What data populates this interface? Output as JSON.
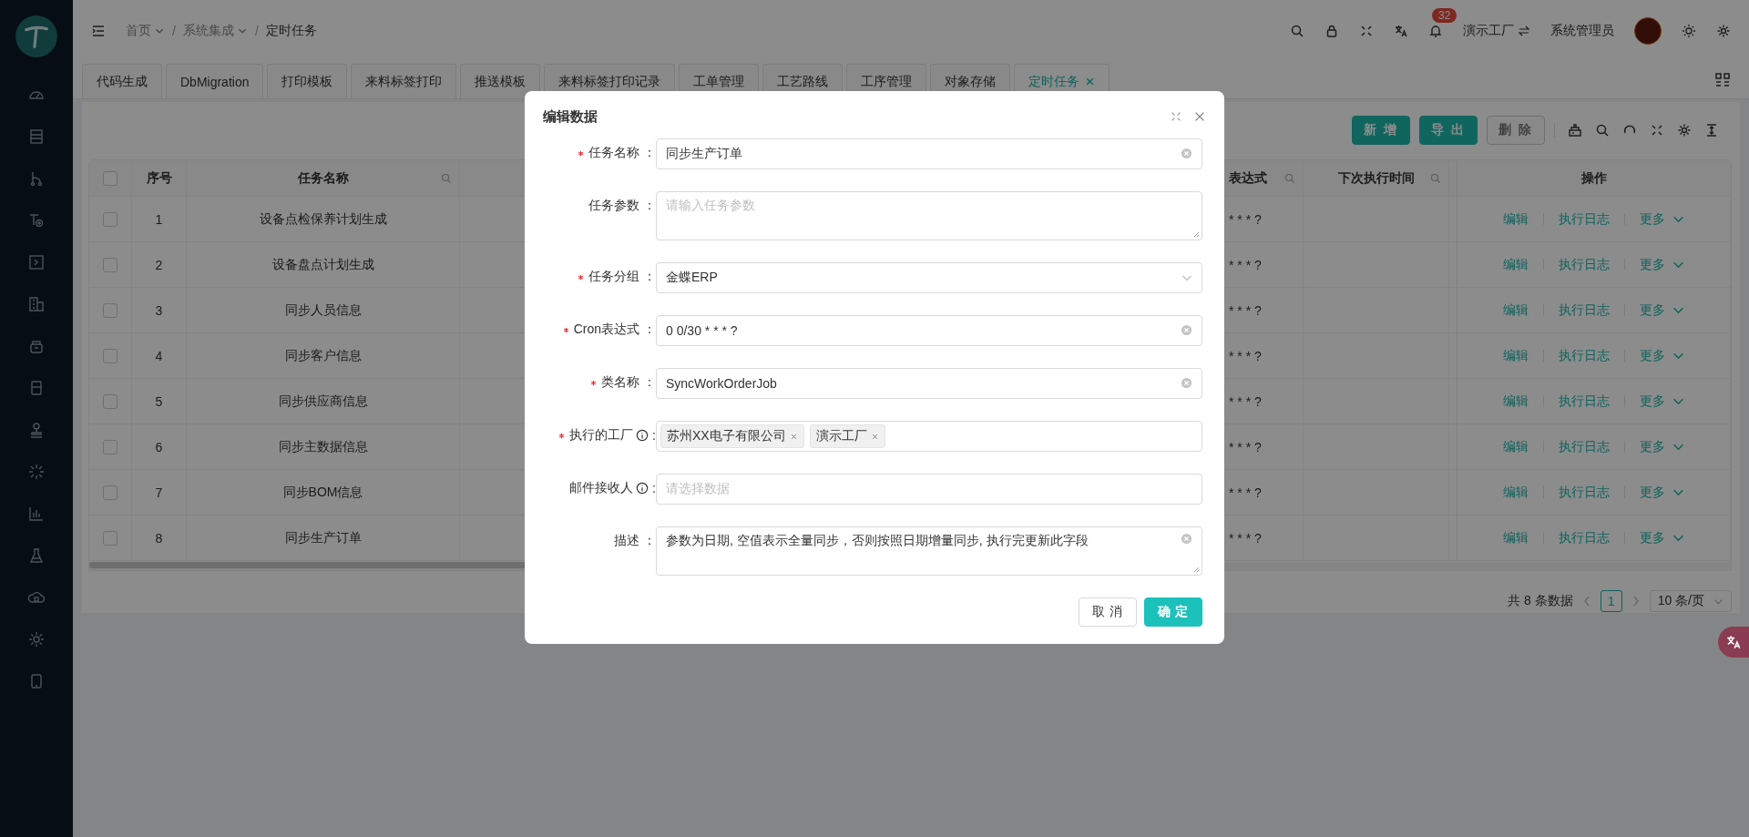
{
  "header": {
    "breadcrumb": [
      {
        "label": "首页",
        "dropdown": true
      },
      {
        "label": "系统集成",
        "dropdown": true
      },
      {
        "label": "定时任务",
        "dropdown": false
      }
    ],
    "separator": "/",
    "notification_count": "32",
    "factory": "演示工厂",
    "user": "系统管理员"
  },
  "tabs": [
    {
      "label": "代码生成",
      "selected": false,
      "closable": false
    },
    {
      "label": "DbMigration",
      "selected": false,
      "closable": false
    },
    {
      "label": "打印模板",
      "selected": false,
      "closable": false
    },
    {
      "label": "来料标签打印",
      "selected": false,
      "closable": false
    },
    {
      "label": "推送模板",
      "selected": false,
      "closable": false
    },
    {
      "label": "来料标签打印记录",
      "selected": false,
      "closable": false
    },
    {
      "label": "工单管理",
      "selected": false,
      "closable": false
    },
    {
      "label": "工艺路线",
      "selected": false,
      "closable": false
    },
    {
      "label": "工序管理",
      "selected": false,
      "closable": false
    },
    {
      "label": "对象存储",
      "selected": false,
      "closable": false
    },
    {
      "label": "定时任务",
      "selected": true,
      "closable": true
    }
  ],
  "toolbar": {
    "buttons": [
      {
        "label": "新 增",
        "disabled": false
      },
      {
        "label": "导 出",
        "disabled": false
      },
      {
        "label": "删 除",
        "disabled": true
      }
    ]
  },
  "table": {
    "all_checked": false,
    "columns": [
      {
        "label": "序号",
        "filterable": false
      },
      {
        "label": "任务名称",
        "filterable": true
      },
      {
        "label": "表达式",
        "filterable": true
      },
      {
        "label": "下次执行时间",
        "filterable": true
      },
      {
        "label": "操作",
        "filterable": false
      }
    ],
    "rows": [
      {
        "index": "1",
        "name": "设备点检保养计划生成",
        "cron": "* * * ?",
        "checked": false,
        "actions": [
          "编辑",
          "执行日志",
          "更多"
        ]
      },
      {
        "index": "2",
        "name": "设备盘点计划生成",
        "cron": "* * * ?",
        "checked": false,
        "actions": [
          "编辑",
          "执行日志",
          "更多"
        ]
      },
      {
        "index": "3",
        "name": "同步人员信息",
        "cron": "* * * ?",
        "checked": false,
        "actions": [
          "编辑",
          "执行日志",
          "更多"
        ]
      },
      {
        "index": "4",
        "name": "同步客户信息",
        "cron": "* * * ?",
        "checked": false,
        "actions": [
          "编辑",
          "执行日志",
          "更多"
        ]
      },
      {
        "index": "5",
        "name": "同步供应商信息",
        "cron": "* * * ?",
        "checked": false,
        "actions": [
          "编辑",
          "执行日志",
          "更多"
        ]
      },
      {
        "index": "6",
        "name": "同步主数据信息",
        "cron": "* * * ?",
        "checked": false,
        "actions": [
          "编辑",
          "执行日志",
          "更多"
        ]
      },
      {
        "index": "7",
        "name": "同步BOM信息",
        "cron": "* * * ?",
        "checked": false,
        "actions": [
          "编辑",
          "执行日志",
          "更多"
        ]
      },
      {
        "index": "8",
        "name": "同步生产订单",
        "cron": "* * * ?",
        "checked": false,
        "actions": [
          "编辑",
          "执行日志",
          "更多"
        ]
      }
    ]
  },
  "pagination": {
    "total": "共 8 条数据",
    "pages": [
      {
        "label": "1",
        "selected": true
      }
    ],
    "page_size": "10 条/页"
  },
  "dialog": {
    "title": "编辑数据",
    "fields": [
      {
        "kind": "input",
        "label": "任务名称",
        "colon": "：",
        "required": true,
        "info": false,
        "clearable": true,
        "value": "同步生产订单"
      },
      {
        "kind": "textarea",
        "label": "任务参数",
        "colon": "：",
        "required": false,
        "info": false,
        "clearable": false,
        "placeholder": "请输入任务参数"
      },
      {
        "kind": "select",
        "label": "任务分组",
        "colon": "：",
        "required": true,
        "info": false,
        "clearable": false,
        "value": "金蝶ERP"
      },
      {
        "kind": "input",
        "label": "Cron表达式",
        "colon": "：",
        "required": true,
        "info": false,
        "clearable": true,
        "value": "0 0/30 * * * ?"
      },
      {
        "kind": "input",
        "label": "类名称",
        "colon": "：",
        "required": true,
        "info": false,
        "clearable": true,
        "value": "SyncWorkOrderJob"
      },
      {
        "kind": "tags",
        "label": "执行的工厂",
        "colon": ":",
        "required": true,
        "info": true,
        "clearable": false,
        "tags": [
          "苏州XX电子有限公司",
          "演示工厂"
        ]
      },
      {
        "kind": "input",
        "label": "邮件接收人",
        "colon": ":",
        "required": false,
        "info": true,
        "clearable": false,
        "placeholder": "请选择数据"
      },
      {
        "kind": "textarea",
        "label": "描述",
        "colon": "：",
        "required": false,
        "info": false,
        "clearable": true,
        "value": "参数为日期, 空值表示全量同步，否则按照日期增量同步, 执行完更新此字段"
      }
    ],
    "buttons": [
      {
        "label": "取 消",
        "primary": false
      },
      {
        "label": "确 定",
        "primary": true
      }
    ]
  }
}
